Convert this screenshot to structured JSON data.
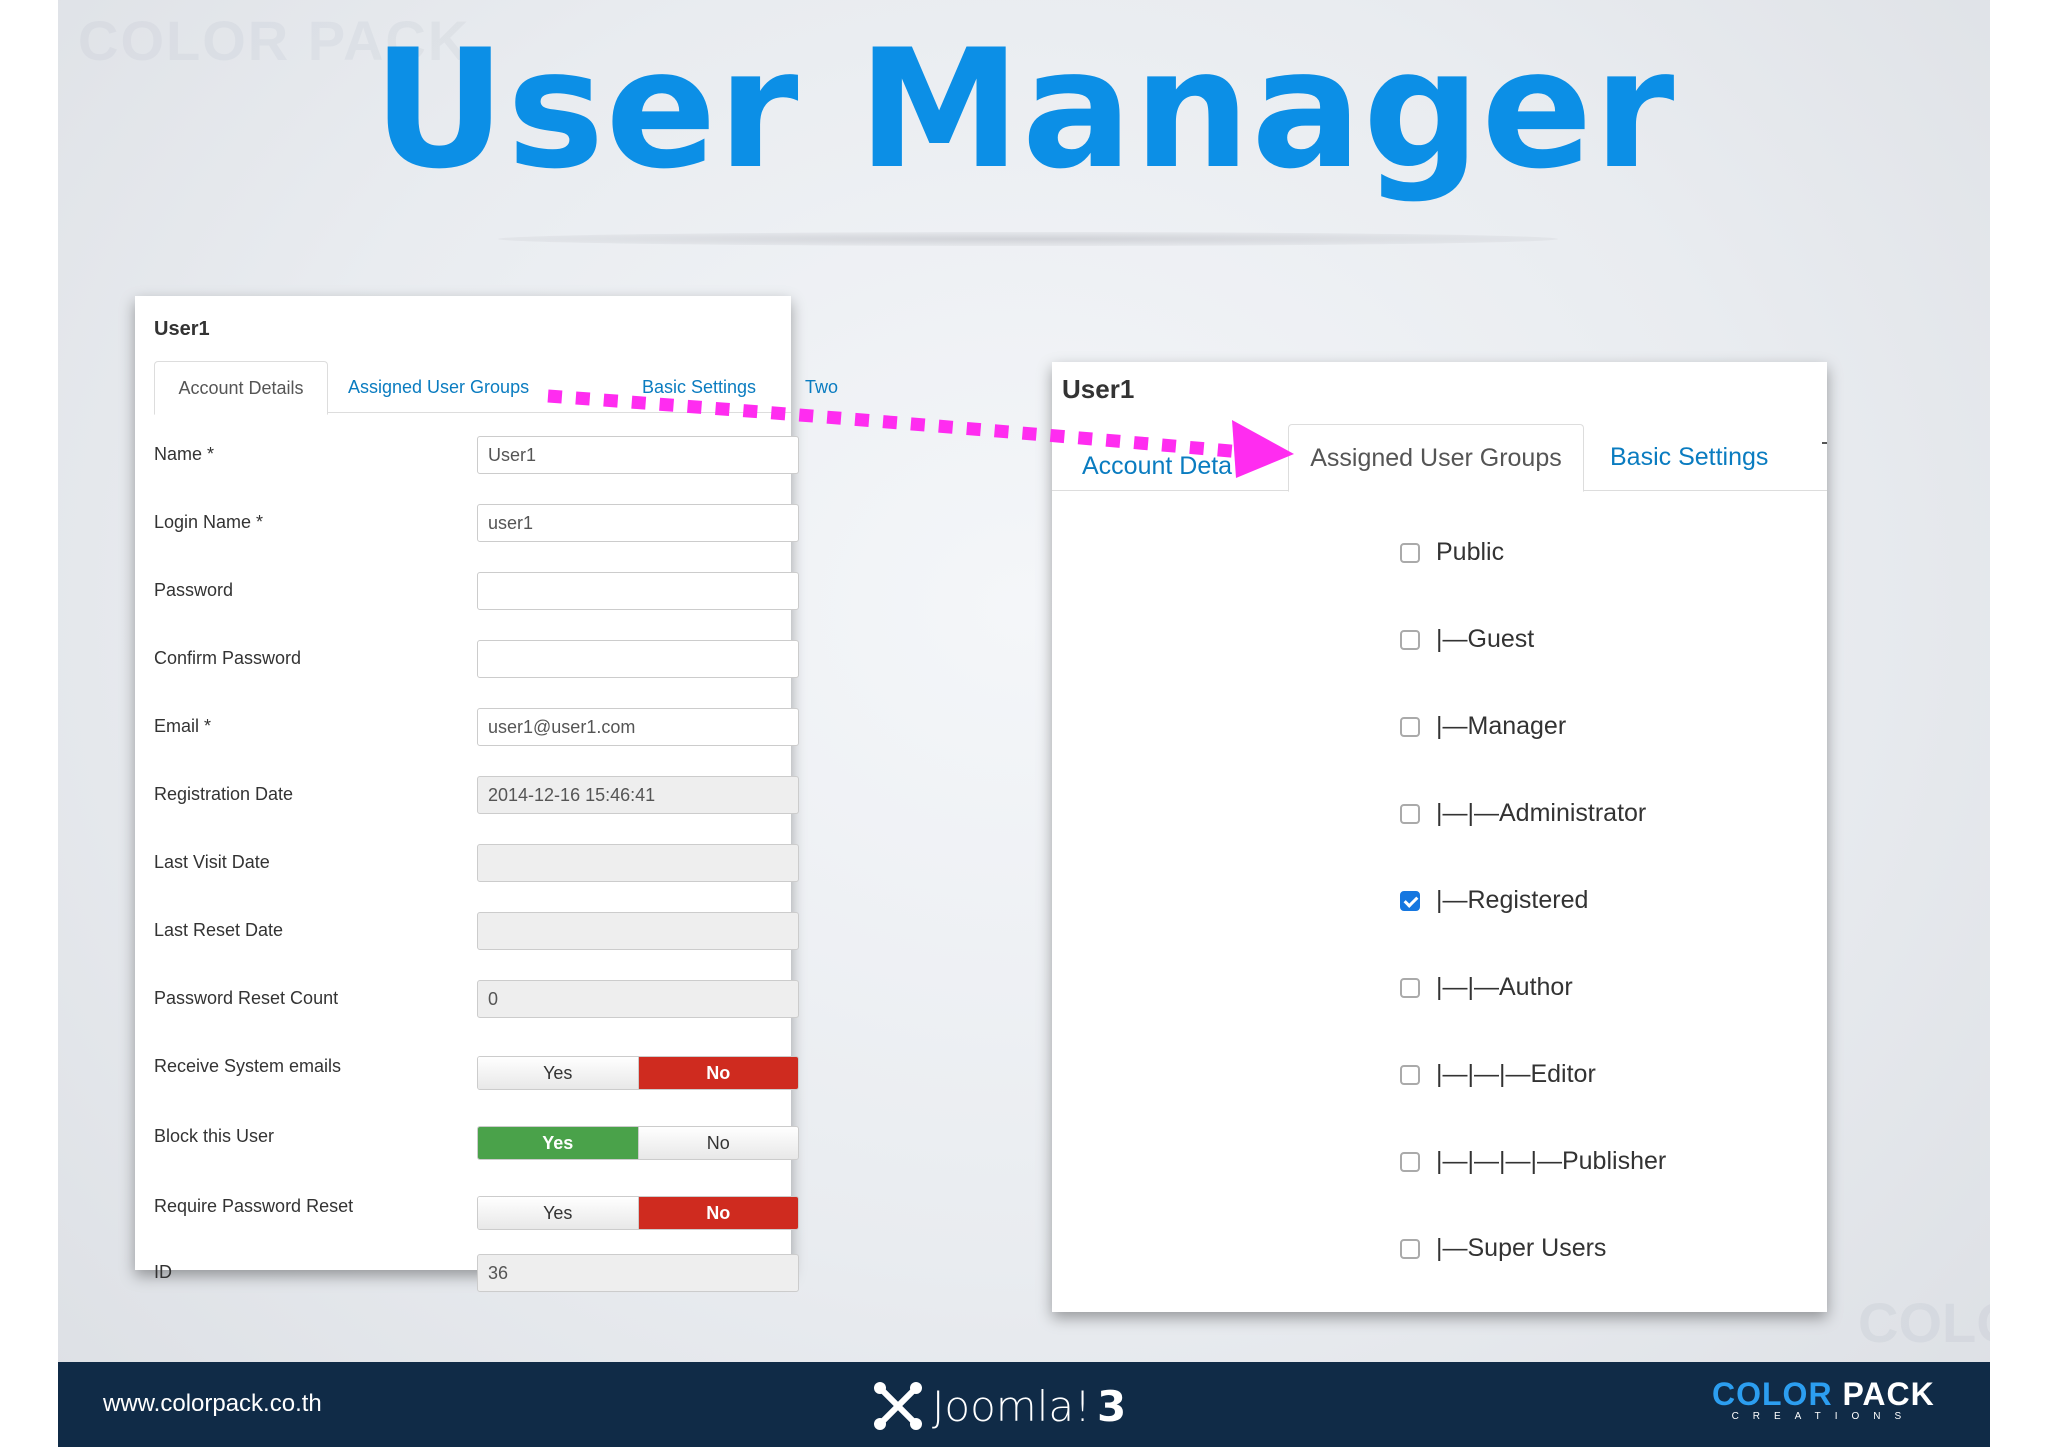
{
  "slide": {
    "title": "User Manager",
    "watermark": "COLOR PACK",
    "title_color": "#0c8fe6"
  },
  "left_panel": {
    "title": "User1",
    "tabs": [
      "Account Details",
      "Assigned User Groups",
      "Basic Settings",
      "Two"
    ],
    "rows": [
      {
        "label": "Name *",
        "value": ""
      },
      {
        "label": "Login Name *",
        "value": ""
      },
      {
        "label": "Password",
        "value": ""
      },
      {
        "label": "Confirm Password",
        "value": ""
      },
      {
        "label": "Email *",
        "value": ""
      },
      {
        "label": "Registration Date",
        "value": ""
      },
      {
        "label": "Last Visit Date",
        "value": ""
      },
      {
        "label": "Last Reset Date",
        "value": ""
      },
      {
        "label": "Password Reset Count",
        "value": ""
      },
      {
        "label": "Receive System emails",
        "value": ""
      },
      {
        "label": "Block this User",
        "value": ""
      },
      {
        "label": "Require Password Reset",
        "value": ""
      },
      {
        "label": "ID",
        "value": ""
      }
    ],
    "fields": {
      "name": "User1",
      "login_name": "user1",
      "password": "",
      "confirm_password": "",
      "email": "user1@user1.com",
      "registration_date": "2014-12-16 15:46:41",
      "last_visit_date": "",
      "last_reset_date": "",
      "password_reset_count": "0",
      "id": "36"
    },
    "toggles": {
      "yes": "Yes",
      "no": "No",
      "receive_system_emails": "No",
      "block_this_user": "Yes",
      "require_password_reset": "No"
    }
  },
  "right_panel": {
    "title": "User1",
    "tabs": [
      "Account Deta",
      "Assigned User Groups",
      "Basic Settings"
    ],
    "groups": [
      {
        "label": "Public",
        "checked": false
      },
      {
        "label": "|—Guest",
        "checked": false
      },
      {
        "label": "|—Manager",
        "checked": false
      },
      {
        "label": "|—|—Administrator",
        "checked": false
      },
      {
        "label": "|—Registered",
        "checked": true
      },
      {
        "label": "|—|—Author",
        "checked": false
      },
      {
        "label": "|—|—|—Editor",
        "checked": false
      },
      {
        "label": "|—|—|—|—Publisher",
        "checked": false
      },
      {
        "label": "|—Super Users",
        "checked": false
      }
    ]
  },
  "arrow": {
    "color": "#ff2cf0"
  },
  "footer": {
    "url": "www.colorpack.co.th",
    "joomla_text": "Joomla!",
    "joomla_version": "3",
    "brand_word1": "COLOR",
    "brand_word2": "PACK",
    "brand_sub": "CREATIONS",
    "background": "#102b47"
  }
}
